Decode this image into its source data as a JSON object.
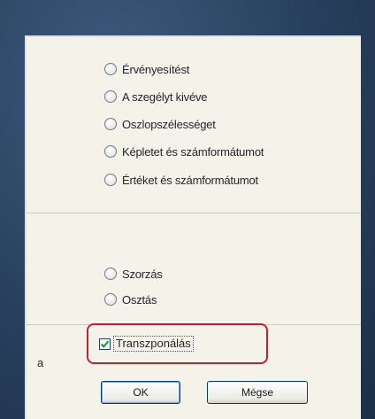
{
  "paste_options": [
    "Érvényesítést",
    "A szegélyt kivéve",
    "Oszlopszélességet",
    "Képletet és számformátumot",
    "Értéket és számformátumot"
  ],
  "operations": [
    "Szorzás",
    "Osztás"
  ],
  "left_fragment": "a",
  "transpose": {
    "label": "Transzponálás",
    "checked": true
  },
  "buttons": {
    "ok": "OK",
    "cancel": "Mégse"
  },
  "colors": {
    "highlight": "#c2202e",
    "dialog_bg": "#f4f2e9",
    "check_mark": "#1f9a2a"
  }
}
